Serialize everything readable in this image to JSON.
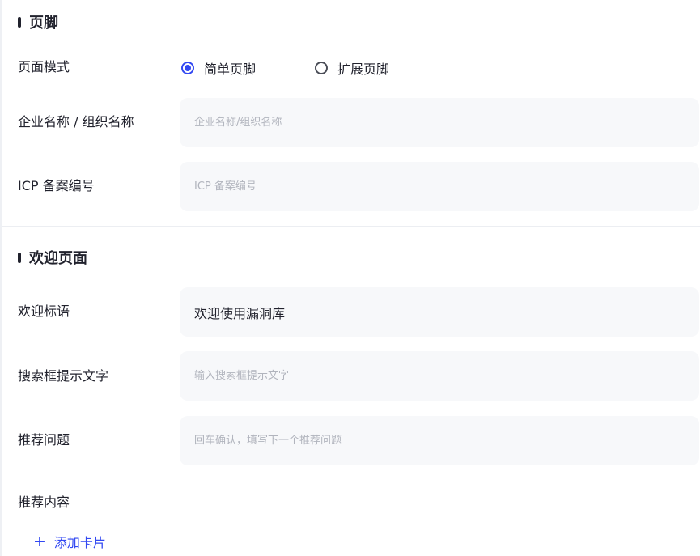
{
  "footer": {
    "title": "页脚",
    "mode": {
      "label": "页面模式",
      "options": [
        {
          "label": "简单页脚",
          "checked": true
        },
        {
          "label": "扩展页脚",
          "checked": false
        }
      ]
    },
    "company_name": {
      "label": "企业名称 / 组织名称",
      "placeholder": "企业名称/组织名称",
      "value": ""
    },
    "icp": {
      "label": "ICP 备案编号",
      "placeholder": "ICP 备案编号",
      "value": ""
    }
  },
  "welcome": {
    "title": "欢迎页面",
    "slogan": {
      "label": "欢迎标语",
      "value": "欢迎使用漏洞库"
    },
    "search_hint": {
      "label": "搜索框提示文字",
      "placeholder": "输入搜索框提示文字",
      "value": ""
    },
    "recommended_questions": {
      "label": "推荐问题",
      "placeholder": "回车确认，填写下一个推荐问题",
      "value": ""
    },
    "recommended_content": {
      "label": "推荐内容",
      "add_label": "添加卡片"
    }
  },
  "colors": {
    "accent": "#3248f2",
    "input_bg": "#f7f8fa",
    "text": "#21222d",
    "placeholder": "#b1b4bd"
  }
}
